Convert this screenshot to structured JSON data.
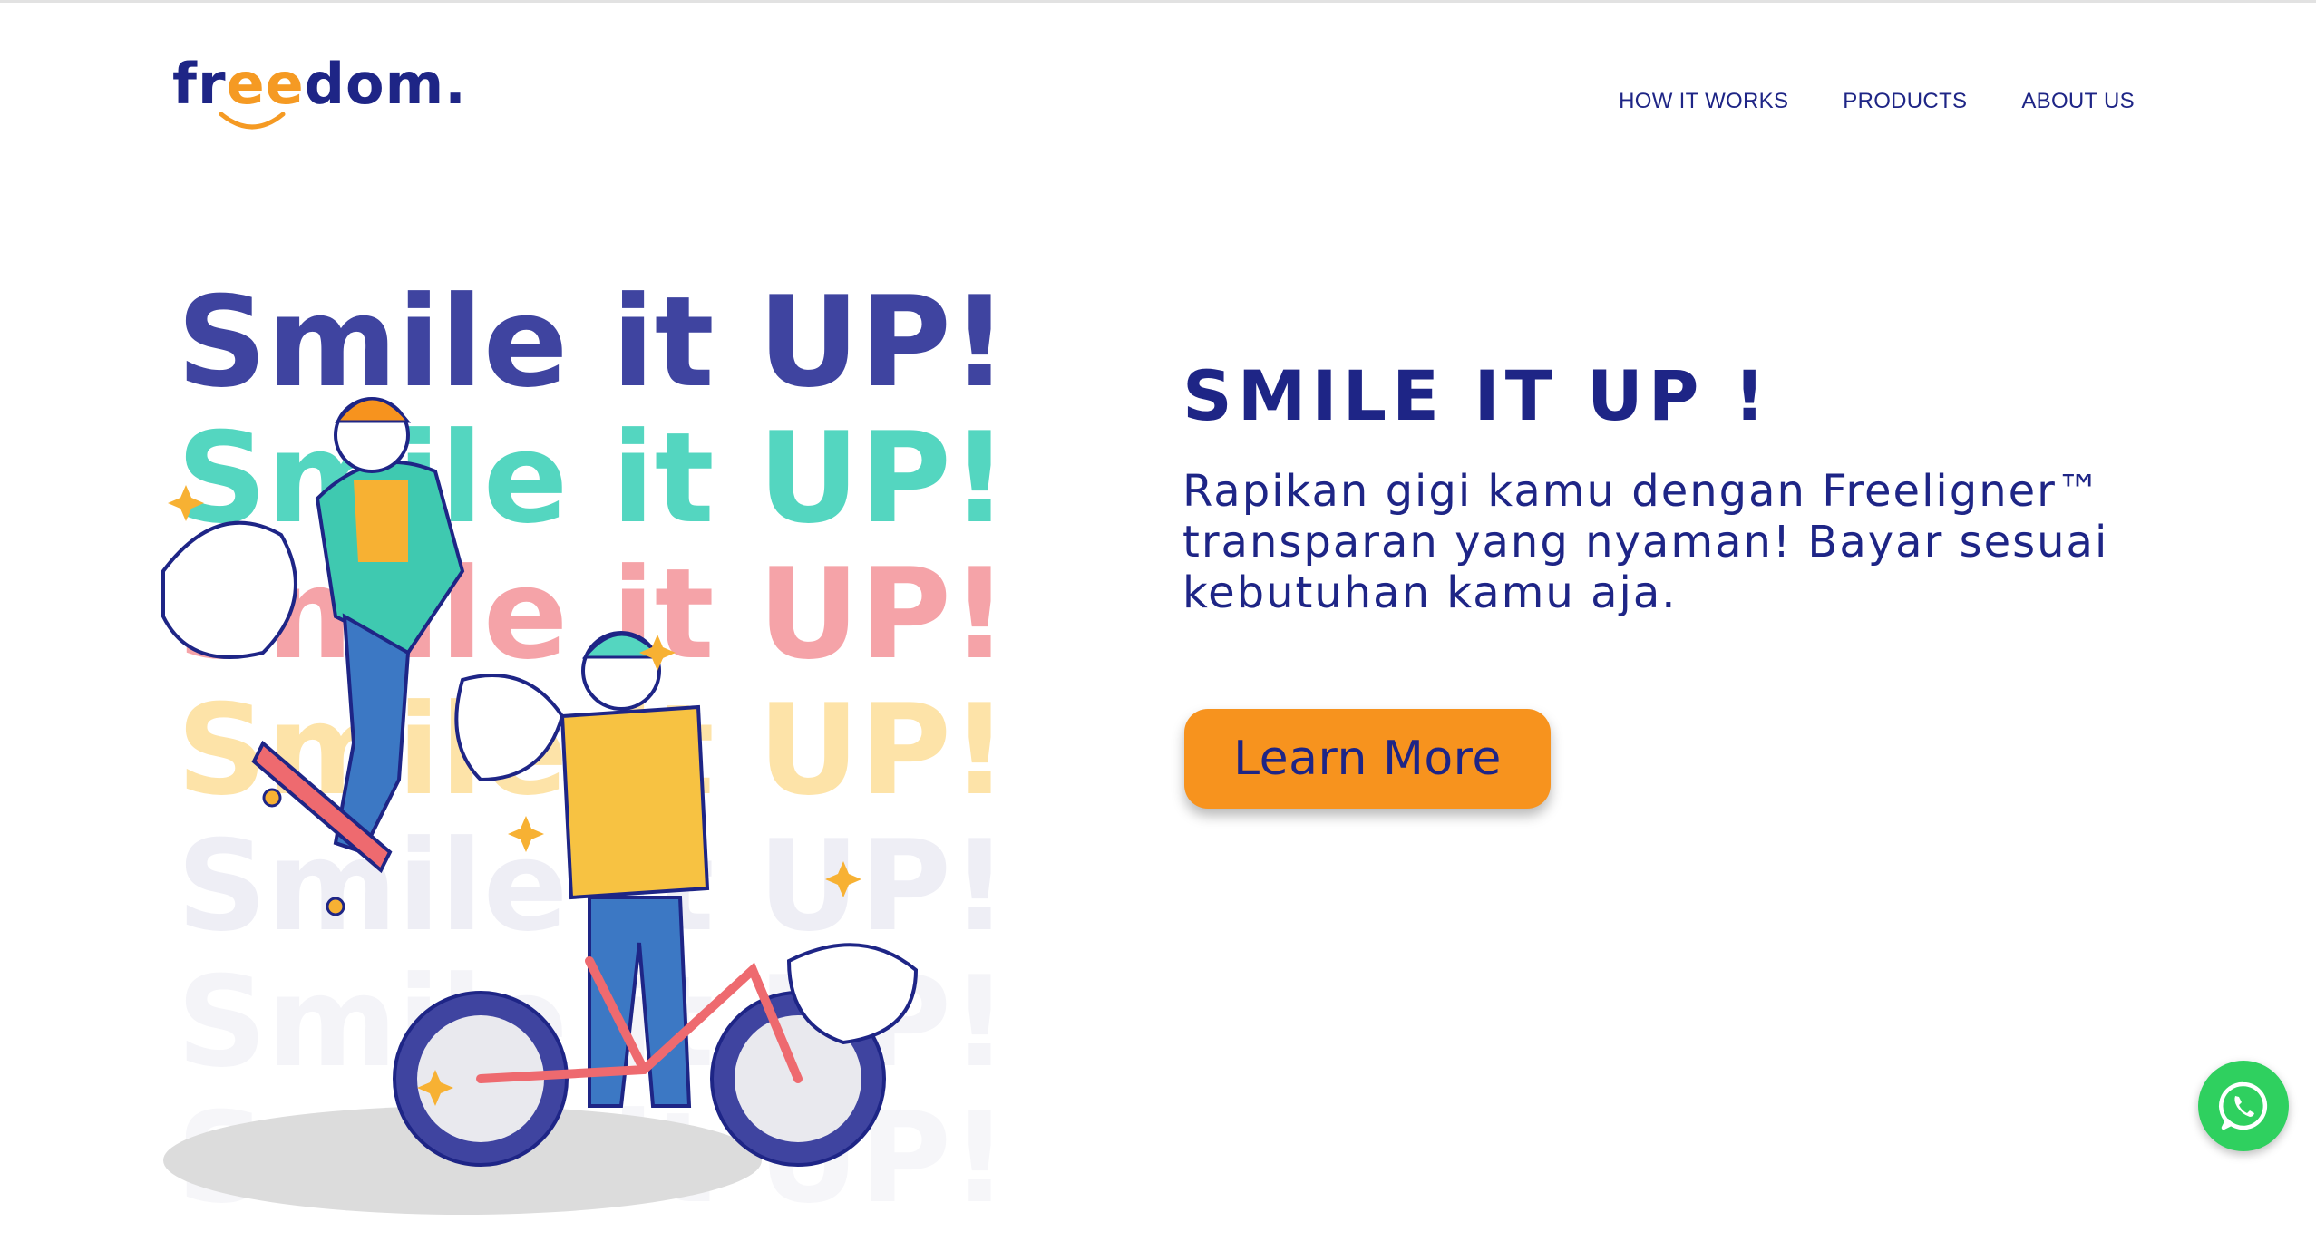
{
  "header": {
    "logo": {
      "prefix": "fr",
      "accent": "ee",
      "suffix": "dom."
    },
    "nav": [
      {
        "label": "HOW IT WORKS"
      },
      {
        "label": "PRODUCTS"
      },
      {
        "label": "ABOUT US"
      }
    ]
  },
  "illustration": {
    "repeated_text": "Smile it UP!",
    "colors": [
      "#3f44a0",
      "#54d6c0",
      "#f5a3a8",
      "#fde3a8",
      "#eeeef5",
      "#f4f4f8"
    ]
  },
  "hero": {
    "title": "SMILE IT UP !",
    "subtitle": "Rapikan gigi kamu dengan Freeligner™ transparan yang nyaman! Bayar sesuai kebutuhan kamu aja.",
    "cta_label": "Learn More"
  },
  "whatsapp": {
    "icon": "whatsapp-icon"
  },
  "colors": {
    "brand_navy": "#1e2586",
    "accent_orange": "#f7931e",
    "whatsapp_green": "#2fd05f"
  }
}
